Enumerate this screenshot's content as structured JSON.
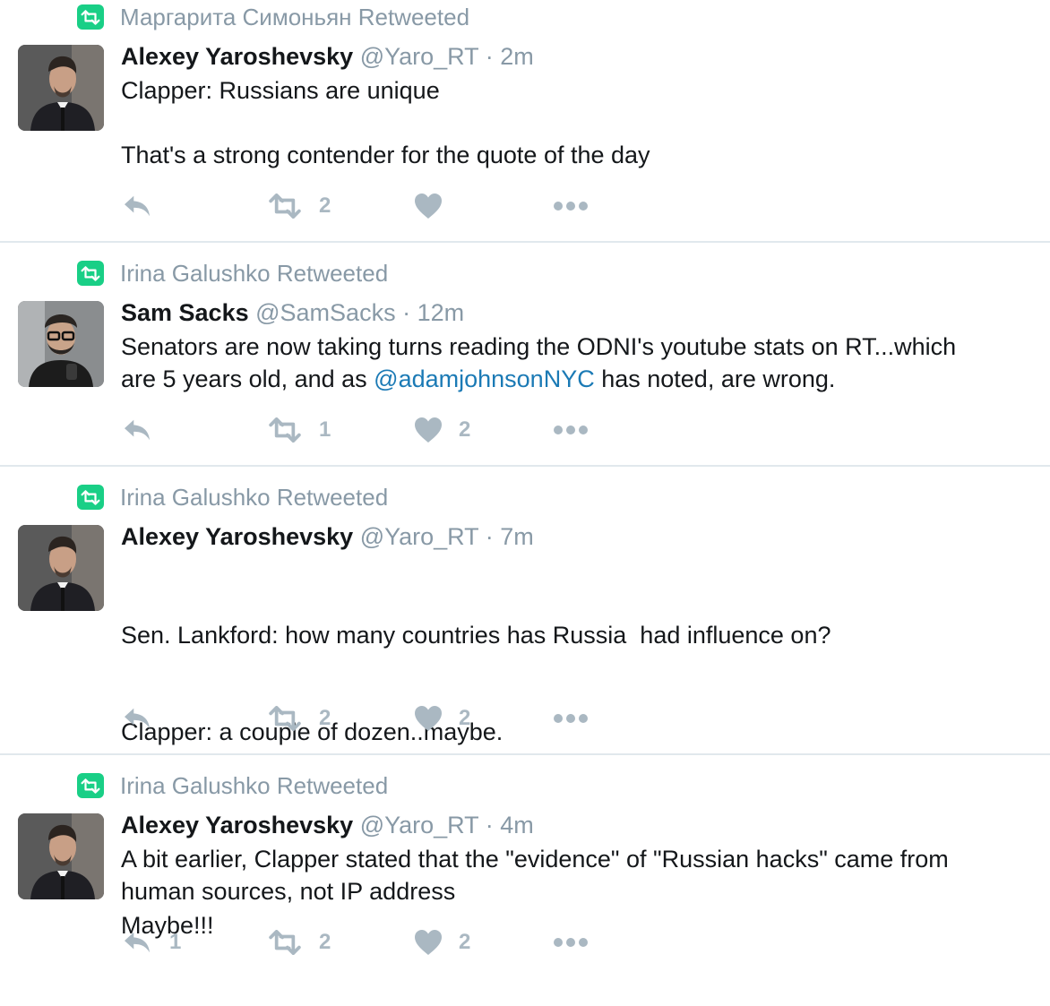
{
  "tweets": [
    {
      "retweeted_by": "Маргарита Симоньян Retweeted",
      "name": "Alexey Yaroshevsky",
      "handle": "@Yaro_RT",
      "time": "2m",
      "lines": [
        "Clapper: Russians are unique",
        "",
        "That's a strong contender for the quote of the day"
      ],
      "reply_count": "",
      "retweet_count": "2",
      "like_count": ""
    },
    {
      "retweeted_by": "Irina Galushko Retweeted",
      "name": "Sam Sacks",
      "handle": "@SamSacks",
      "time": "12m",
      "line1": "Senators are now taking turns reading the ODNI's youtube stats on RT...which",
      "line2_pre": "are 5 years old, and as ",
      "mention": "@adamjohnsonNYC",
      "line2_post": " has noted, are wrong.",
      "reply_count": "",
      "retweet_count": "1",
      "like_count": "2"
    },
    {
      "retweeted_by": "Irina Galushko Retweeted",
      "name": "Alexey Yaroshevsky",
      "handle": "@Yaro_RT",
      "time": "7m",
      "lines": [
        "Sen. Lankford: how many countries has Russia  had influence on?",
        "Clapper: a couple of dozen..maybe.",
        "",
        "Maybe!!!"
      ],
      "reply_count": "",
      "retweet_count": "2",
      "like_count": "2"
    },
    {
      "retweeted_by": "Irina Galushko Retweeted",
      "name": "Alexey Yaroshevsky",
      "handle": "@Yaro_RT",
      "time": "4m",
      "lines": [
        "A bit earlier, Clapper stated that the \"evidence\" of \"Russian hacks\" came from",
        "human sources, not IP address"
      ],
      "reply_count": "1",
      "retweet_count": "2",
      "like_count": "2"
    }
  ],
  "separator": " · ",
  "icons": [
    "retweet-badge-icon",
    "reply-icon",
    "retweet-icon",
    "heart-icon",
    "more-icon"
  ],
  "colors": {
    "retweet_badge": "#19cf86",
    "meta_gray": "#8899a6",
    "action_gray": "#aab8c2",
    "mention_blue": "#1b7ab5",
    "separator": "#e1e8ed"
  }
}
